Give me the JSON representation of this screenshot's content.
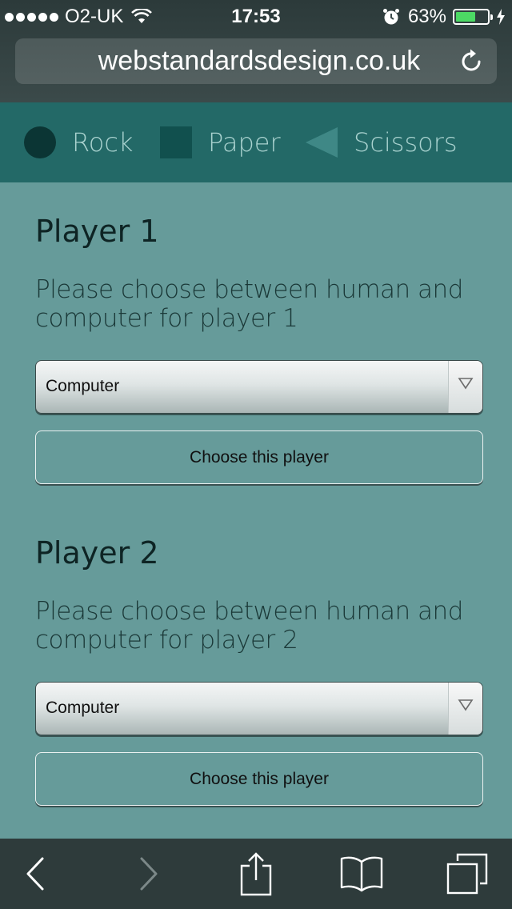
{
  "status_bar": {
    "carrier": "O2-UK",
    "time": "17:53",
    "battery_percent": "63%",
    "battery_level": 0.63,
    "battery_color": "#4cd964"
  },
  "browser": {
    "url": "webstandardsdesign.co.uk",
    "icons": {
      "reload": "reload-icon",
      "back": "back-arrow-icon",
      "forward": "forward-arrow-icon",
      "share": "share-icon",
      "bookmarks": "bookmarks-icon",
      "tabs": "tabs-icon"
    }
  },
  "nav": {
    "items": [
      {
        "label": "Rock",
        "shape": "circle"
      },
      {
        "label": "Paper",
        "shape": "square"
      },
      {
        "label": "Scissors",
        "shape": "triangle"
      }
    ]
  },
  "players": [
    {
      "title": "Player 1",
      "description": "Please choose between human and computer for player 1",
      "selected": "Computer",
      "button_label": "Choose this player"
    },
    {
      "title": "Player 2",
      "description": "Please choose between human and computer for player 2",
      "selected": "Computer",
      "button_label": "Choose this player"
    }
  ],
  "colors": {
    "page_background": "#669b9a",
    "nav_background": "#236967",
    "nav_text": "#a9d2cf"
  }
}
